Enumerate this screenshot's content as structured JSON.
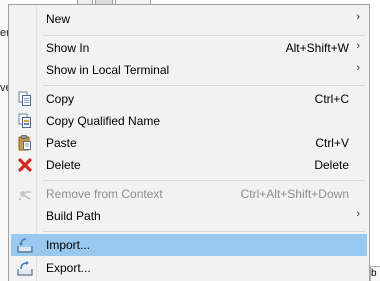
{
  "background": {
    "left_fragments": [
      "en",
      "ve"
    ],
    "bottom_right_fragment": "b"
  },
  "menu": {
    "items": [
      {
        "label": "New",
        "shortcut": "",
        "submenu": true,
        "icon": "",
        "enabled": true
      },
      {
        "label": "Show In",
        "shortcut": "Alt+Shift+W",
        "submenu": true,
        "icon": "",
        "enabled": true
      },
      {
        "label": "Show in Local Terminal",
        "shortcut": "",
        "submenu": true,
        "icon": "",
        "enabled": true
      },
      {
        "label": "Copy",
        "shortcut": "Ctrl+C",
        "submenu": false,
        "icon": "copy-icon",
        "enabled": true
      },
      {
        "label": "Copy Qualified Name",
        "shortcut": "",
        "submenu": false,
        "icon": "copy-qualified-name-icon",
        "enabled": true
      },
      {
        "label": "Paste",
        "shortcut": "Ctrl+V",
        "submenu": false,
        "icon": "paste-icon",
        "enabled": true
      },
      {
        "label": "Delete",
        "shortcut": "Delete",
        "submenu": false,
        "icon": "delete-icon",
        "enabled": true
      },
      {
        "label": "Remove from Context",
        "shortcut": "Ctrl+Alt+Shift+Down",
        "submenu": false,
        "icon": "remove-context-icon",
        "enabled": false
      },
      {
        "label": "Build Path",
        "shortcut": "",
        "submenu": true,
        "icon": "",
        "enabled": true
      },
      {
        "label": "Import...",
        "shortcut": "",
        "submenu": false,
        "icon": "import-icon",
        "enabled": true,
        "highlighted": true
      },
      {
        "label": "Export...",
        "shortcut": "",
        "submenu": false,
        "icon": "export-icon",
        "enabled": true
      }
    ],
    "submenu_arrow": "›"
  },
  "colors": {
    "menu_bg": "#f2f2f2",
    "highlight": "#99c9ef",
    "disabled_text": "#8d8d8d",
    "delete_red": "#d9261c"
  }
}
